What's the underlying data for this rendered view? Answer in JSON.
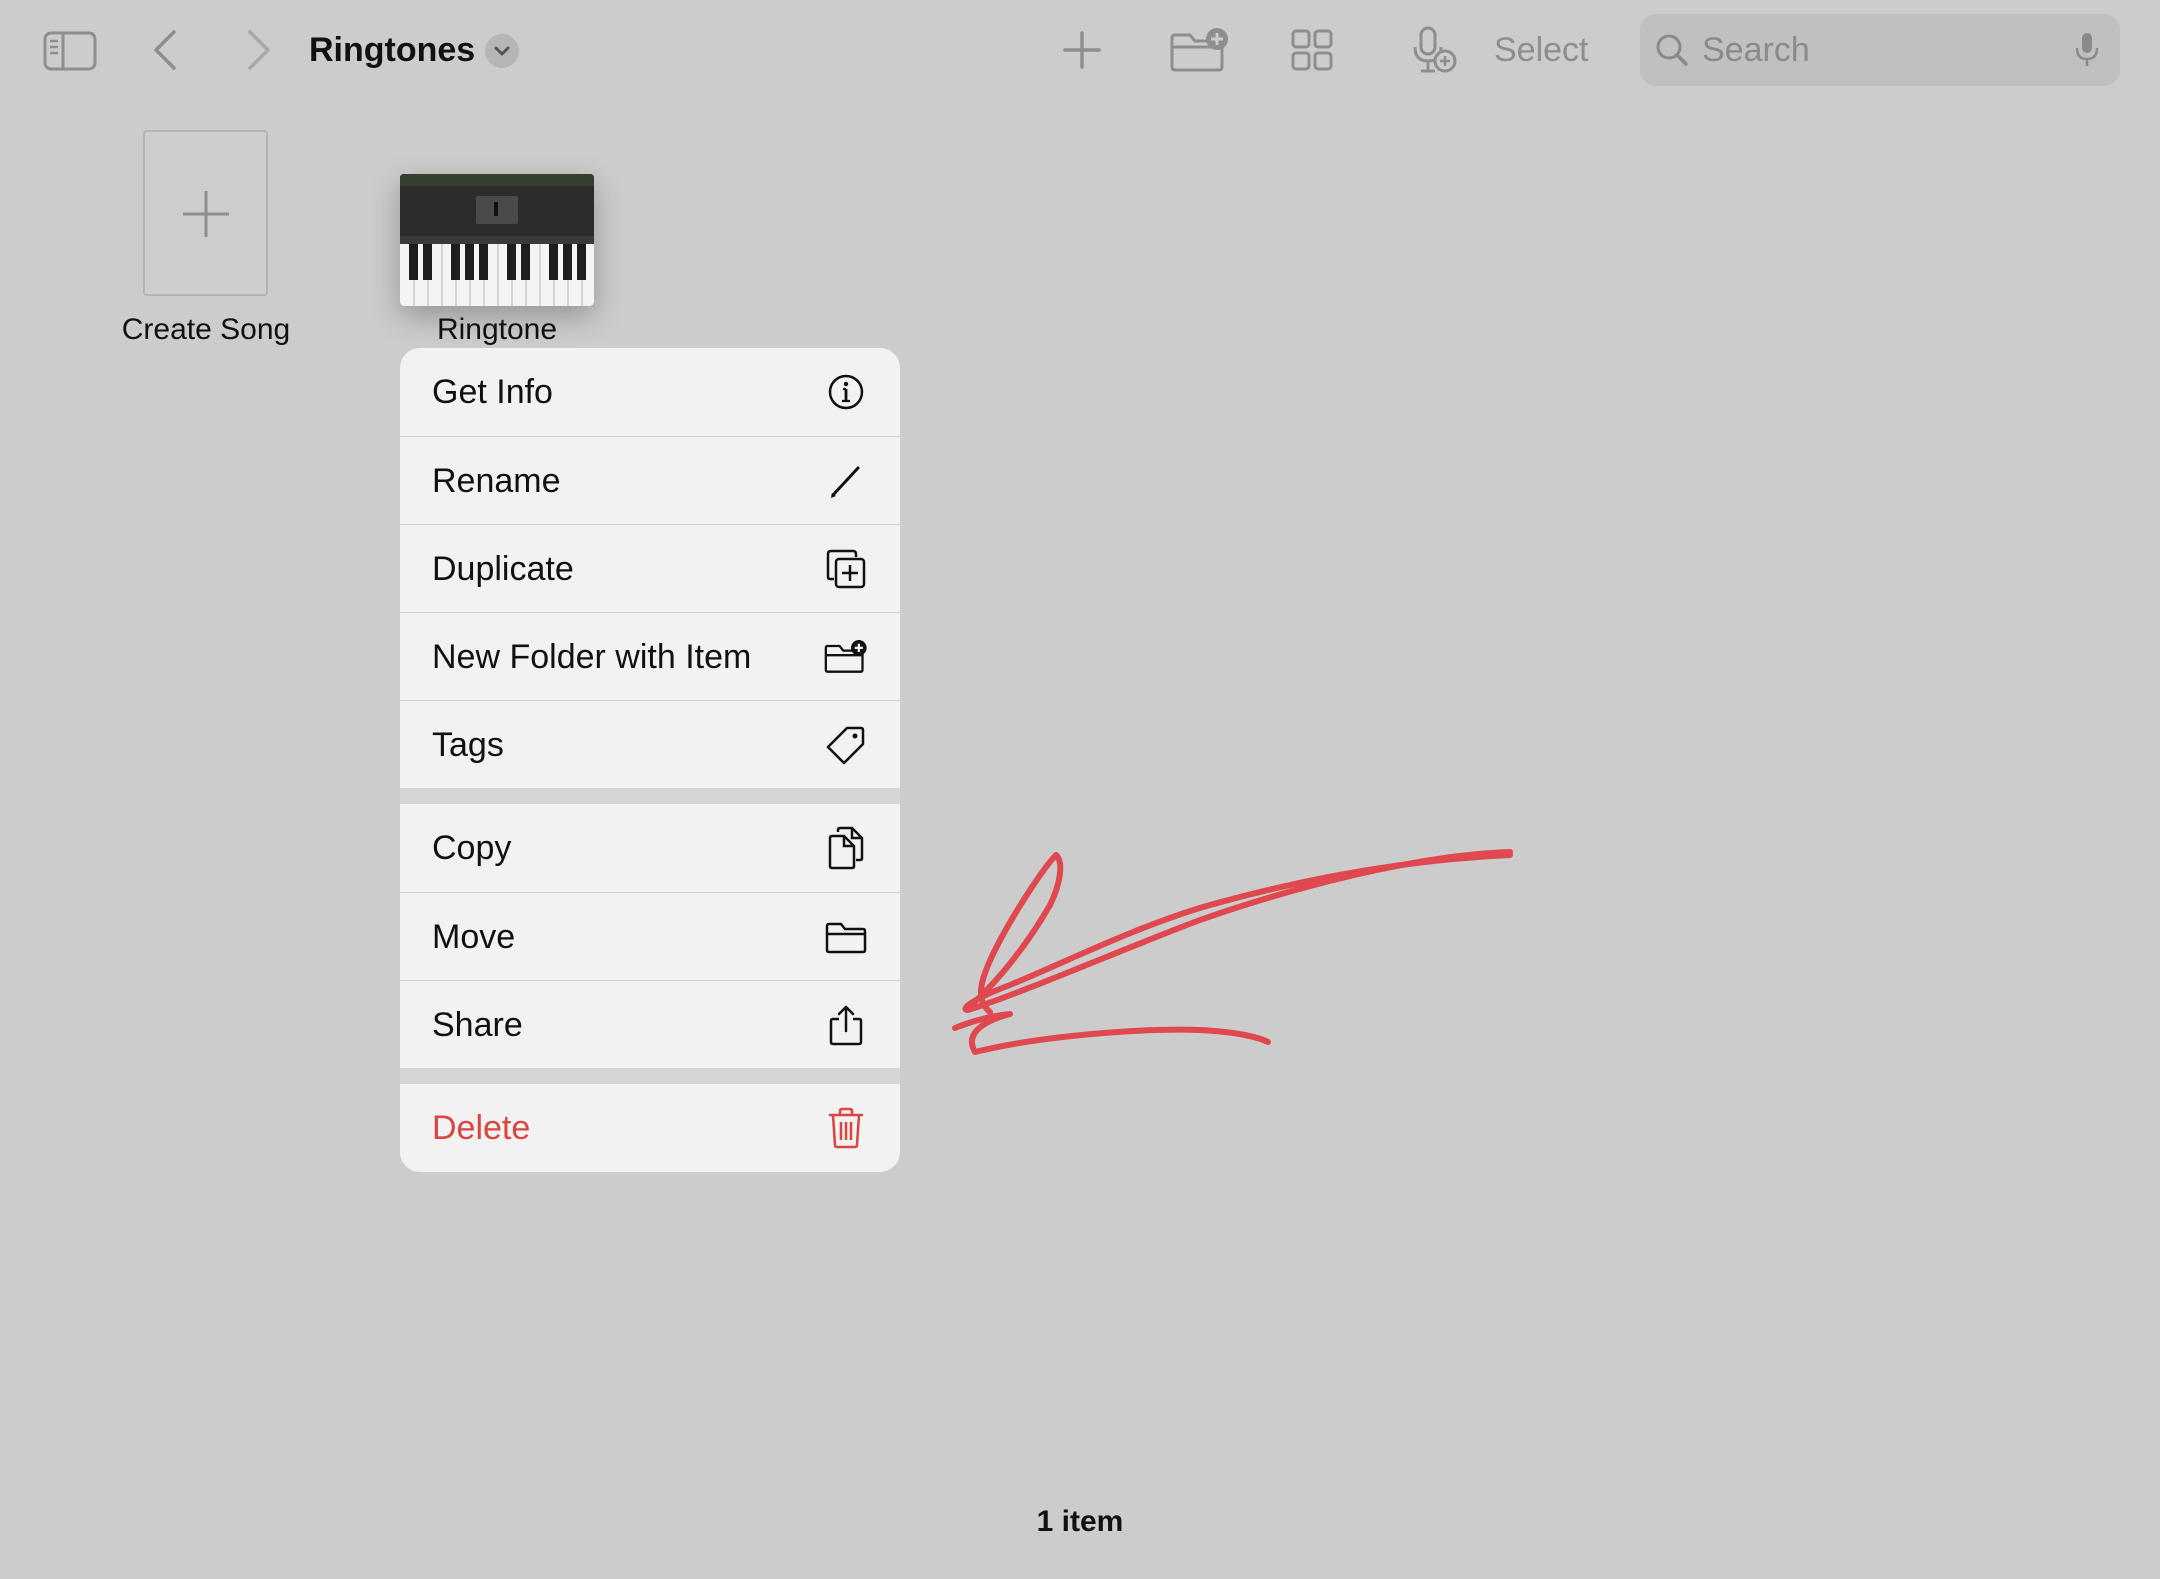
{
  "toolbar": {
    "title": "Ringtones",
    "select_label": "Select",
    "search_placeholder": "Search",
    "icons": [
      "sidebar-icon",
      "back-chevron-icon",
      "forward-chevron-icon",
      "chevron-down-icon",
      "plus-icon",
      "folder-plus-icon",
      "grid-view-icon",
      "mic-plus-icon",
      "magnifier-icon",
      "microphone-icon"
    ]
  },
  "items": [
    {
      "label": "Create Song",
      "icon": "plus-icon"
    },
    {
      "label": "Ringtone",
      "icon": "piano-thumbnail"
    }
  ],
  "context_menu": {
    "groups": [
      [
        {
          "label": "Get Info",
          "icon": "info-icon"
        },
        {
          "label": "Rename",
          "icon": "pencil-icon"
        },
        {
          "label": "Duplicate",
          "icon": "duplicate-icon"
        },
        {
          "label": "New Folder with Item",
          "icon": "folder-plus-icon"
        },
        {
          "label": "Tags",
          "icon": "tag-icon"
        }
      ],
      [
        {
          "label": "Copy",
          "icon": "copy-icon"
        },
        {
          "label": "Move",
          "icon": "folder-icon"
        },
        {
          "label": "Share",
          "icon": "share-icon"
        }
      ],
      [
        {
          "label": "Delete",
          "icon": "trash-icon",
          "destructive": true
        }
      ]
    ]
  },
  "footer": {
    "item_count": "1 item"
  },
  "colors": {
    "background": "#cccccc",
    "menu_background": "#f2f2f2",
    "destructive": "#d9453f",
    "annotation": "#e0484f",
    "icon_gray": "#8e8e8e"
  }
}
